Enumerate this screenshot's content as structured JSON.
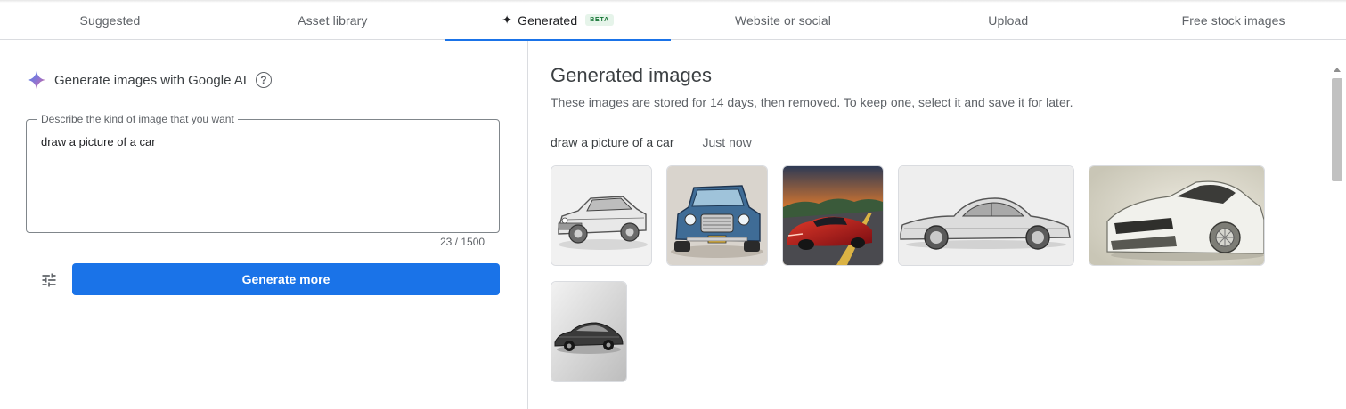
{
  "tabs": [
    {
      "label": "Suggested"
    },
    {
      "label": "Asset library"
    },
    {
      "label": "Generated",
      "badge": "BETA",
      "active": true
    },
    {
      "label": "Website or social"
    },
    {
      "label": "Upload"
    },
    {
      "label": "Free stock images"
    }
  ],
  "left": {
    "title": "Generate images with Google AI",
    "help_icon": "help-circle-icon",
    "prompt_label": "Describe the kind of image that you want",
    "prompt_value": "draw a picture of a car",
    "counter": "23 / 1500",
    "generate_button": "Generate more",
    "settings_icon": "tune-icon"
  },
  "right": {
    "title": "Generated images",
    "subtitle": "These images are stored for 14 days, then removed. To keep one, select it and save it for later.",
    "query": "draw a picture of a car",
    "time": "Just now",
    "images": [
      {
        "name": "sketch-classic-coupe"
      },
      {
        "name": "blue-vintage-car"
      },
      {
        "name": "red-sports-car-sunset"
      },
      {
        "name": "silver-classic-sports-car"
      },
      {
        "name": "white-muscle-car-sketch"
      },
      {
        "name": "black-corvette-sketch"
      }
    ]
  },
  "colors": {
    "accent": "#1a73e8",
    "beta_text": "#137333",
    "beta_bg": "#e6f4ea"
  }
}
